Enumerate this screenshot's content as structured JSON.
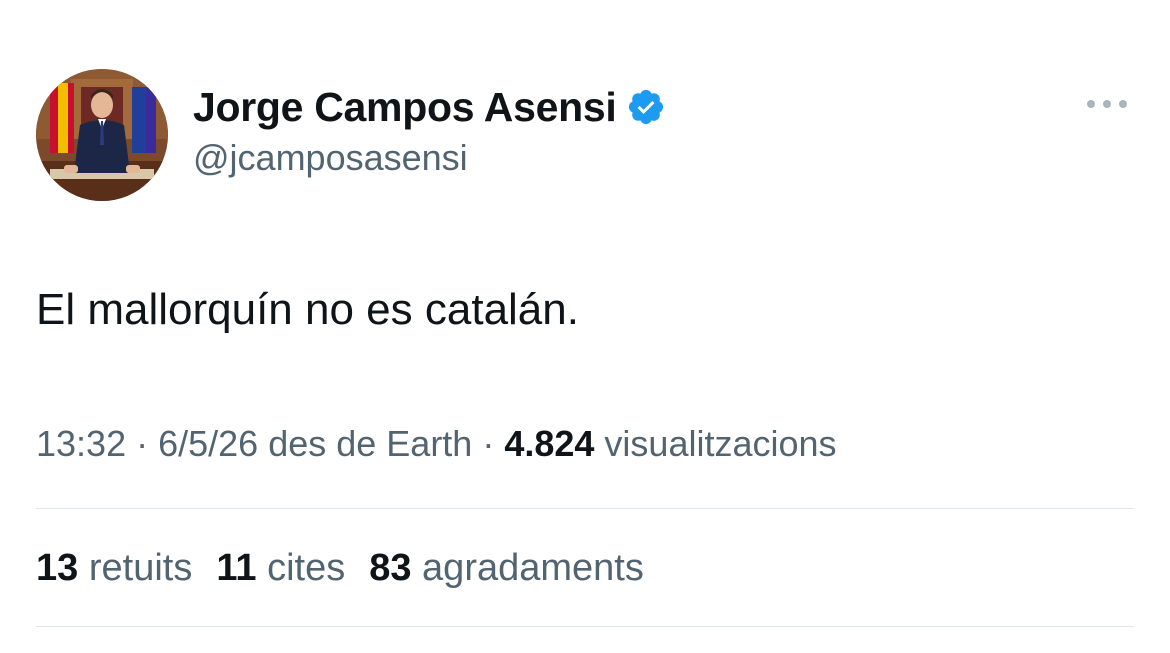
{
  "tweet": {
    "author": {
      "display_name": "Jorge Campos Asensi",
      "handle": "@jcamposasensi",
      "verified_icon": "verified-badge-icon",
      "avatar_icon": "avatar-photo"
    },
    "more_icon": "more-options-icon",
    "text": "El mallorquín no es catalán.",
    "meta": {
      "time": "13:32",
      "separator": " · ",
      "date": "6/5/26",
      "source": " des de Earth",
      "views_count": "4.824",
      "views_label": " visualitzacions"
    },
    "stats": [
      {
        "count": "13",
        "label": "retuits"
      },
      {
        "count": "11",
        "label": "cites"
      },
      {
        "count": "83",
        "label": "agradaments"
      }
    ]
  },
  "colors": {
    "text_primary": "#0f1419",
    "text_secondary": "#536471",
    "verified_blue": "#1d9bf0",
    "divider": "#e1e6ea"
  }
}
